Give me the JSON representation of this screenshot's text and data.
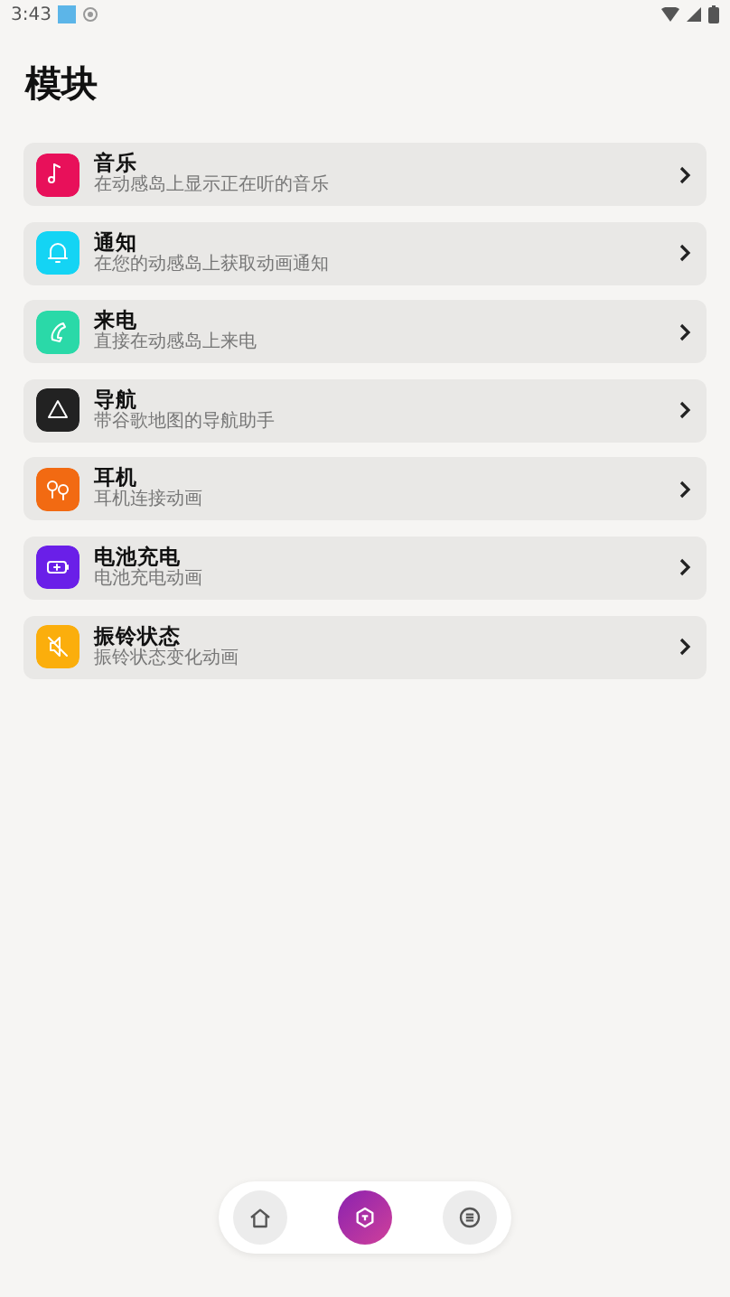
{
  "status_bar": {
    "time": "3:43"
  },
  "title": "模块",
  "modules": [
    {
      "title": "音乐",
      "subtitle": "在动感岛上显示正在听的音乐",
      "color": "#e8105a",
      "kind": "music"
    },
    {
      "title": "通知",
      "subtitle": "在您的动感岛上获取动画通知",
      "color": "#14d4f4",
      "kind": "bell"
    },
    {
      "title": "来电",
      "subtitle": "直接在动感岛上来电",
      "color": "#2ad9a8",
      "kind": "phone"
    },
    {
      "title": "导航",
      "subtitle": "带谷歌地图的导航助手",
      "color": "#222222",
      "kind": "nav"
    },
    {
      "title": "耳机",
      "subtitle": "耳机连接动画",
      "color": "#f26a12",
      "kind": "earbuds"
    },
    {
      "title": "电池充电",
      "subtitle": "电池充电动画",
      "color": "#6a1fe8",
      "kind": "battery"
    },
    {
      "title": "振铃状态",
      "subtitle": "振铃状态变化动画",
      "color": "#fbae0c",
      "kind": "mute"
    }
  ],
  "nav": [
    {
      "kind": "home",
      "selected": false
    },
    {
      "kind": "modules",
      "selected": true
    },
    {
      "kind": "menu",
      "selected": false
    }
  ]
}
